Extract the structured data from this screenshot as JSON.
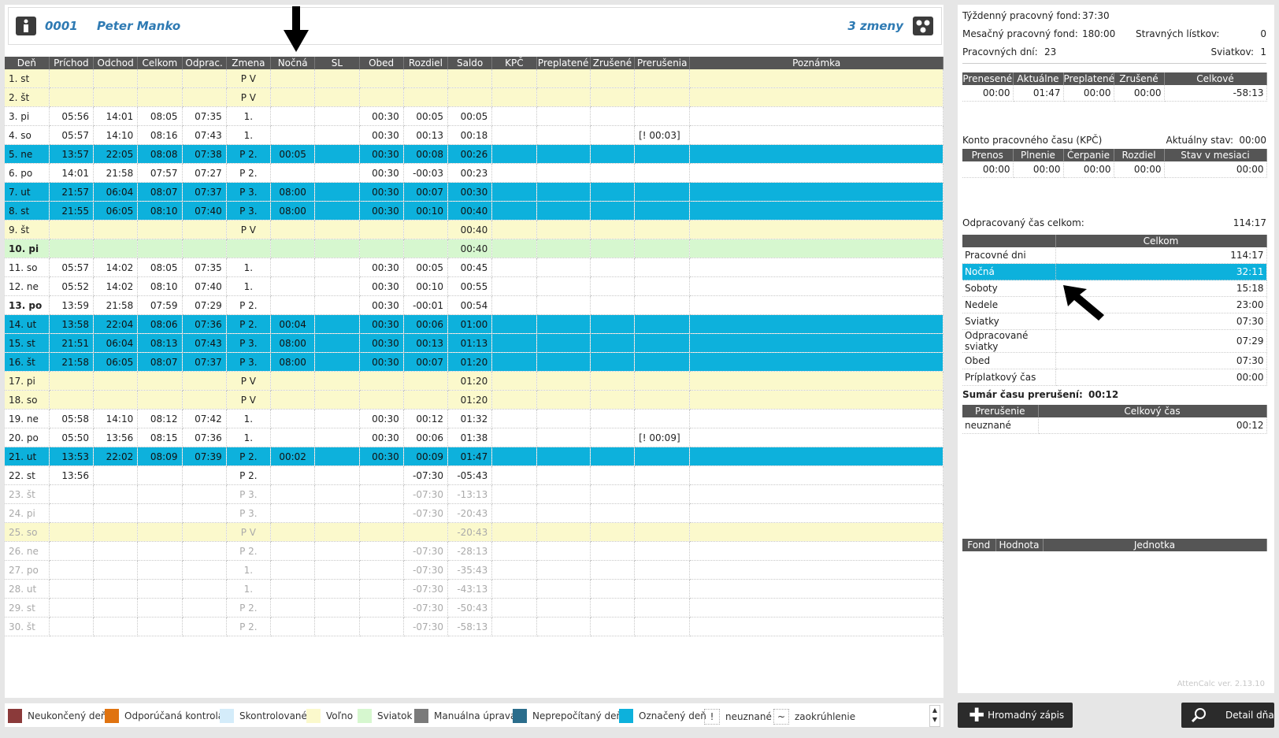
{
  "header": {
    "employee_id": "0001",
    "employee_name": "Peter Manko",
    "shifts": "3 zmeny"
  },
  "table": {
    "columns": [
      "Deň",
      "Príchod",
      "Odchod",
      "Celkom",
      "Odprac.",
      "Zmena",
      "Nočná",
      "SL",
      "Obed",
      "Rozdiel",
      "Saldo",
      "KPČ",
      "Preplatené",
      "Zrušené",
      "Prerušenia",
      "Poznámka"
    ],
    "rows": [
      {
        "type": "weekend",
        "cells": [
          "1. st",
          "",
          "",
          "",
          "",
          "P V",
          "",
          "",
          "",
          "",
          "",
          "",
          "",
          "",
          "",
          ""
        ]
      },
      {
        "type": "weekend",
        "cells": [
          "2. št",
          "",
          "",
          "",
          "",
          "P V",
          "",
          "",
          "",
          "",
          "",
          "",
          "",
          "",
          "",
          ""
        ]
      },
      {
        "type": "normal",
        "cells": [
          "3. pi",
          "05:56",
          "14:01",
          "08:05",
          "07:35",
          "1.",
          "",
          "",
          "00:30",
          "00:05",
          "00:05",
          "",
          "",
          "",
          "",
          ""
        ]
      },
      {
        "type": "normal",
        "cells": [
          "4. so",
          "05:57",
          "14:10",
          "08:16",
          "07:43",
          "1.",
          "",
          "",
          "00:30",
          "00:13",
          "00:18",
          "",
          "",
          "",
          "[! 00:03]",
          ""
        ]
      },
      {
        "type": "marked",
        "cells": [
          "5. ne",
          "13:57",
          "22:05",
          "08:08",
          "07:38",
          "P 2.",
          "00:05",
          "",
          "00:30",
          "00:08",
          "00:26",
          "",
          "",
          "",
          "",
          ""
        ]
      },
      {
        "type": "normal",
        "cells": [
          "6. po",
          "14:01",
          "21:58",
          "07:57",
          "07:27",
          "P 2.",
          "",
          "",
          "00:30",
          "-00:03",
          "00:23",
          "",
          "",
          "",
          "",
          ""
        ]
      },
      {
        "type": "marked",
        "cells": [
          "7. ut",
          "21:57",
          "06:04",
          "08:07",
          "07:37",
          "P 3.",
          "08:00",
          "",
          "00:30",
          "00:07",
          "00:30",
          "",
          "",
          "",
          "",
          ""
        ]
      },
      {
        "type": "marked",
        "cells": [
          "8. st",
          "21:55",
          "06:05",
          "08:10",
          "07:40",
          "P 3.",
          "08:00",
          "",
          "00:30",
          "00:10",
          "00:40",
          "",
          "",
          "",
          "",
          ""
        ]
      },
      {
        "type": "weekend",
        "cells": [
          "9. št",
          "",
          "",
          "",
          "",
          "P V",
          "",
          "",
          "",
          "",
          "00:40",
          "",
          "",
          "",
          "",
          ""
        ]
      },
      {
        "type": "holiday",
        "bold": true,
        "cells": [
          "10. pi",
          "",
          "",
          "",
          "",
          "",
          "",
          "",
          "",
          "",
          "00:40",
          "",
          "",
          "",
          "",
          ""
        ]
      },
      {
        "type": "normal",
        "cells": [
          "11. so",
          "05:57",
          "14:02",
          "08:05",
          "07:35",
          "1.",
          "",
          "",
          "00:30",
          "00:05",
          "00:45",
          "",
          "",
          "",
          "",
          ""
        ]
      },
      {
        "type": "normal",
        "cells": [
          "12. ne",
          "05:52",
          "14:02",
          "08:10",
          "07:40",
          "1.",
          "",
          "",
          "00:30",
          "00:10",
          "00:55",
          "",
          "",
          "",
          "",
          ""
        ]
      },
      {
        "type": "normal",
        "bold": true,
        "cells": [
          "13. po",
          "13:59",
          "21:58",
          "07:59",
          "07:29",
          "P 2.",
          "",
          "",
          "00:30",
          "-00:01",
          "00:54",
          "",
          "",
          "",
          "",
          ""
        ]
      },
      {
        "type": "marked",
        "cells": [
          "14. ut",
          "13:58",
          "22:04",
          "08:06",
          "07:36",
          "P 2.",
          "00:04",
          "",
          "00:30",
          "00:06",
          "01:00",
          "",
          "",
          "",
          "",
          ""
        ]
      },
      {
        "type": "marked",
        "cells": [
          "15. st",
          "21:51",
          "06:04",
          "08:13",
          "07:43",
          "P 3.",
          "08:00",
          "",
          "00:30",
          "00:13",
          "01:13",
          "",
          "",
          "",
          "",
          ""
        ]
      },
      {
        "type": "marked",
        "cells": [
          "16. št",
          "21:58",
          "06:05",
          "08:07",
          "07:37",
          "P 3.",
          "08:00",
          "",
          "00:30",
          "00:07",
          "01:20",
          "",
          "",
          "",
          "",
          ""
        ]
      },
      {
        "type": "weekend",
        "cells": [
          "17. pi",
          "",
          "",
          "",
          "",
          "P V",
          "",
          "",
          "",
          "",
          "01:20",
          "",
          "",
          "",
          "",
          ""
        ]
      },
      {
        "type": "weekend",
        "cells": [
          "18. so",
          "",
          "",
          "",
          "",
          "P V",
          "",
          "",
          "",
          "",
          "01:20",
          "",
          "",
          "",
          "",
          ""
        ]
      },
      {
        "type": "normal",
        "cells": [
          "19. ne",
          "05:58",
          "14:10",
          "08:12",
          "07:42",
          "1.",
          "",
          "",
          "00:30",
          "00:12",
          "01:32",
          "",
          "",
          "",
          "",
          ""
        ]
      },
      {
        "type": "normal",
        "cells": [
          "20. po",
          "05:50",
          "13:56",
          "08:15",
          "07:36",
          "1.",
          "",
          "",
          "00:30",
          "00:06",
          "01:38",
          "",
          "",
          "",
          "[! 00:09]",
          ""
        ]
      },
      {
        "type": "marked",
        "cells": [
          "21. ut",
          "13:53",
          "22:02",
          "08:09",
          "07:39",
          "P 2.",
          "00:02",
          "",
          "00:30",
          "00:09",
          "01:47",
          "",
          "",
          "",
          "",
          ""
        ]
      },
      {
        "type": "normal",
        "cells": [
          "22. st",
          "13:56",
          "",
          "",
          "",
          "P 2.",
          "",
          "",
          "",
          "-07:30",
          "-05:43",
          "",
          "",
          "",
          "",
          ""
        ]
      },
      {
        "type": "future",
        "cells": [
          "23. št",
          "",
          "",
          "",
          "",
          "P 3.",
          "",
          "",
          "",
          "-07:30",
          "-13:13",
          "",
          "",
          "",
          "",
          ""
        ]
      },
      {
        "type": "future",
        "cells": [
          "24. pi",
          "",
          "",
          "",
          "",
          "P 3.",
          "",
          "",
          "",
          "-07:30",
          "-20:43",
          "",
          "",
          "",
          "",
          ""
        ]
      },
      {
        "type": "weekend future",
        "cells": [
          "25. so",
          "",
          "",
          "",
          "",
          "P V",
          "",
          "",
          "",
          "",
          "-20:43",
          "",
          "",
          "",
          "",
          ""
        ]
      },
      {
        "type": "future",
        "cells": [
          "26. ne",
          "",
          "",
          "",
          "",
          "P 2.",
          "",
          "",
          "",
          "-07:30",
          "-28:13",
          "",
          "",
          "",
          "",
          ""
        ]
      },
      {
        "type": "future",
        "cells": [
          "27. po",
          "",
          "",
          "",
          "",
          "1.",
          "",
          "",
          "",
          "-07:30",
          "-35:43",
          "",
          "",
          "",
          "",
          ""
        ]
      },
      {
        "type": "future",
        "cells": [
          "28. ut",
          "",
          "",
          "",
          "",
          "1.",
          "",
          "",
          "",
          "-07:30",
          "-43:13",
          "",
          "",
          "",
          "",
          ""
        ]
      },
      {
        "type": "future",
        "cells": [
          "29. st",
          "",
          "",
          "",
          "",
          "P 2.",
          "",
          "",
          "",
          "-07:30",
          "-50:43",
          "",
          "",
          "",
          "",
          ""
        ]
      },
      {
        "type": "future",
        "cells": [
          "30. št",
          "",
          "",
          "",
          "",
          "P 2.",
          "",
          "",
          "",
          "-07:30",
          "-58:13",
          "",
          "",
          "",
          "",
          ""
        ]
      }
    ]
  },
  "legend": [
    {
      "label": "Neukončený deň",
      "color": "#8b3a3a"
    },
    {
      "label": "Odporúčaná kontrola",
      "color": "#e07310"
    },
    {
      "label": "Skontrolované",
      "color": "#d4ecfa"
    },
    {
      "label": "Voľno",
      "color": "#fbf9cc"
    },
    {
      "label": "Sviatok",
      "color": "#d6f7cf"
    },
    {
      "label": "Manuálna úprava",
      "color": "#7a7a7a"
    },
    {
      "label": "Neprepočítaný deň",
      "color": "#2b6d8c"
    },
    {
      "label": "Označený deň",
      "color": "#0db1dc"
    },
    {
      "label": "neuznané",
      "symbol": "!"
    },
    {
      "label": "zaokrúhlenie",
      "symbol": "~"
    }
  ],
  "summary": {
    "weekly_fund_label": "Týždenný pracovný fond:",
    "weekly_fund": "37:30",
    "monthly_fund_label": "Mesačný pracovný fond:",
    "monthly_fund": "180:00",
    "meal_label": "Stravných lístkov:",
    "meal": "0",
    "workdays_label": "Pracovných dní:",
    "workdays": "23",
    "holidays_label": "Sviatkov:",
    "holidays": "1",
    "balance_headers": [
      "Prenesené",
      "Aktuálne",
      "Preplatené",
      "Zrušené",
      "Celkové"
    ],
    "balance_values": [
      "00:00",
      "01:47",
      "00:00",
      "00:00",
      "-58:13"
    ],
    "kpc_title": "Konto pracovného času (KPČ)",
    "kpc_state_label": "Aktuálny stav:",
    "kpc_state": "00:00",
    "kpc_headers": [
      "Prenos",
      "Plnenie",
      "Čerpanie",
      "Rozdiel",
      "Stav v mesiaci"
    ],
    "kpc_values": [
      "00:00",
      "00:00",
      "00:00",
      "00:00",
      "00:00"
    ],
    "worked_label": "Odpracovaný čas celkom:",
    "worked": "114:17",
    "worked_header": "Celkom",
    "worked_rows": [
      {
        "label": "Pracovné dni",
        "value": "114:17"
      },
      {
        "label": "Nočná",
        "value": "32:11",
        "highlight": true
      },
      {
        "label": "Soboty",
        "value": "15:18"
      },
      {
        "label": "Nedele",
        "value": "23:00"
      },
      {
        "label": "Sviatky",
        "value": "07:30"
      },
      {
        "label": "Odpracované sviatky",
        "value": "07:29"
      },
      {
        "label": "Obed",
        "value": "07:30"
      },
      {
        "label": "Príplatkový čas",
        "value": "00:00"
      }
    ],
    "interrupt_label": "Sumár času prerušení:",
    "interrupt": "00:12",
    "interrupt_headers": [
      "Prerušenie",
      "Celkový čas"
    ],
    "interrupt_rows": [
      {
        "label": "neuznané",
        "value": "00:12"
      }
    ],
    "fund_headers": [
      "Fond",
      "Hodnota",
      "Jednotka"
    ],
    "version": "AttenCalc ver. 2.13.10"
  },
  "buttons": {
    "bulk": "Hromadný zápis",
    "detail": "Detail dňa"
  }
}
